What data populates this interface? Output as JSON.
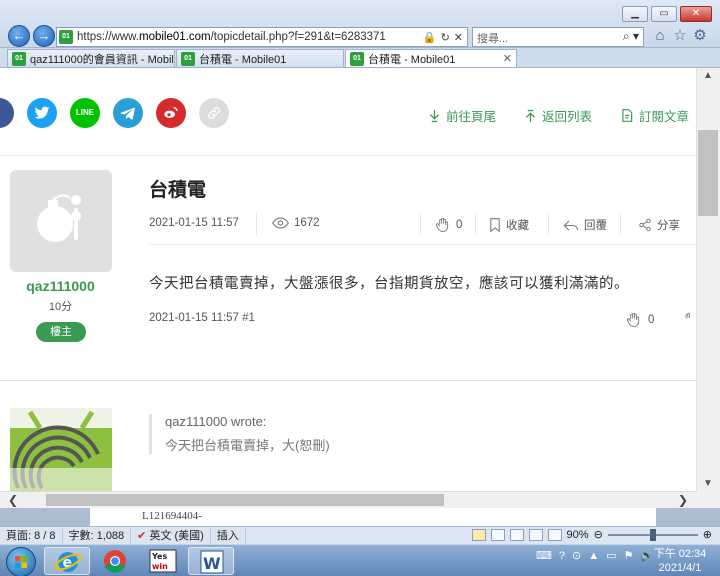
{
  "browser": {
    "url_prefix": "https://www.",
    "url_domain": "mobile01.com",
    "url_path": "/topicdetail.php?f=291&t=6283371",
    "search_placeholder": "搜尋...",
    "tabs": [
      {
        "label": "qaz111000的會員資訊 - Mobil..."
      },
      {
        "label": "台積電 - Mobile01"
      },
      {
        "label": "台積電 - Mobile01"
      }
    ]
  },
  "page": {
    "nav": {
      "last_page": "前往頁尾",
      "back_to_list": "返回列表",
      "subscribe": "訂閱文章"
    },
    "share": {
      "line_label": "LINE"
    },
    "post": {
      "title": "台積電",
      "datetime": "2021-01-15 11:57",
      "views": "1672",
      "likes": "0",
      "bookmark_label": "收藏",
      "reply_label": "回覆",
      "share_label": "分享",
      "body": "今天把台積電賣掉，大盤漲很多，台指期貨放空，應該可以獲利滿滿的。",
      "footer": "2021-01-15 11:57 #1",
      "footer_likes": "0"
    },
    "author": {
      "username": "qaz111000",
      "score": "10分",
      "badge": "樓主"
    },
    "reply": {
      "quote_author": "qaz111000 wrote:",
      "quote_text": "今天把台積電賣掉，大(恕刪)"
    }
  },
  "word": {
    "doc_text": "L121694404-",
    "status": {
      "page": "頁面: 8 / 8",
      "words": "字數: 1,088",
      "language": "英文 (美國)",
      "mode": "插入",
      "zoom": "90%"
    }
  },
  "taskbar": {
    "time": "下午 02:34",
    "date": "2021/4/1"
  },
  "colors": {
    "brand_green": "#3a9a52",
    "facebook": "#3b5998",
    "twitter": "#1da1f2",
    "line": "#00c300",
    "telegram": "#2a9fd6",
    "weibo": "#d52b2b"
  }
}
